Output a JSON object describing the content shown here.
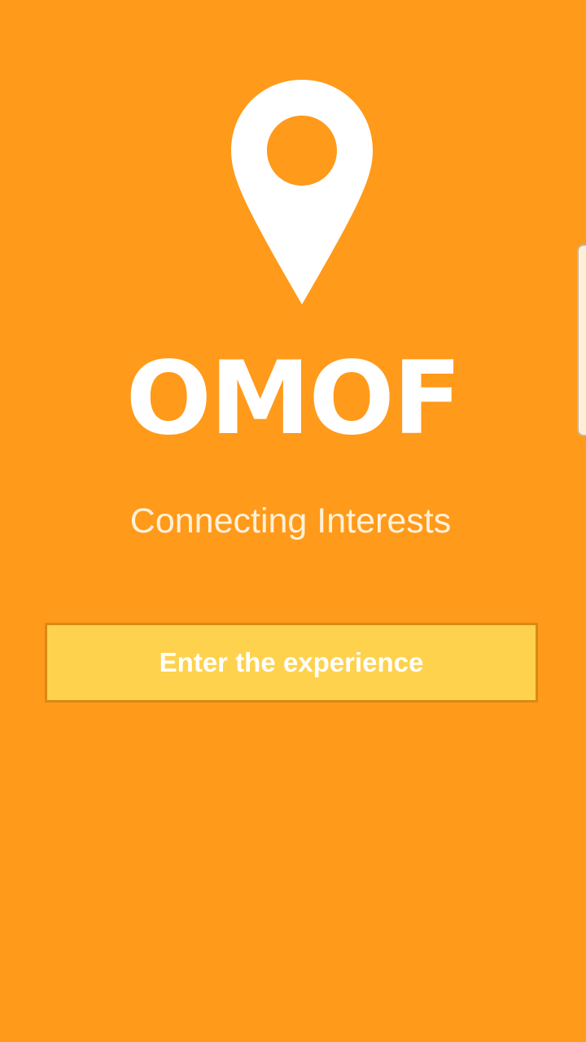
{
  "app": {
    "title": "OMOF",
    "tagline": "Connecting Interests"
  },
  "actions": {
    "enter_label": "Enter the experience"
  },
  "icons": {
    "logo": "location-pin-icon"
  },
  "colors": {
    "background": "#FF9A1A",
    "button_fill": "#FFD24D",
    "button_border": "#D98A12",
    "text": "#FFFFFF"
  }
}
